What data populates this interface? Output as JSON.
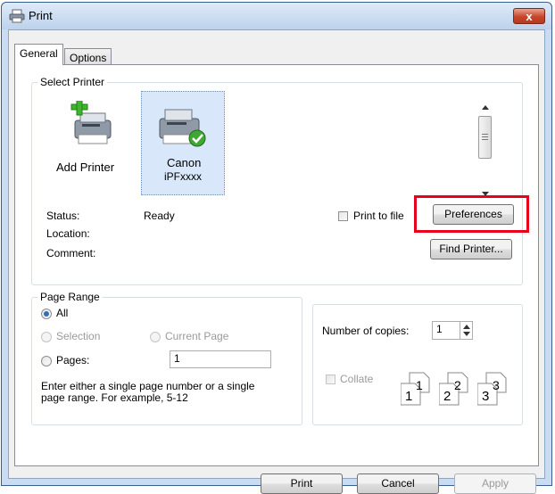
{
  "window": {
    "title": "Print",
    "close_glyph": "x",
    "close_color": "#c8462b"
  },
  "tabs": [
    {
      "label": "General"
    },
    {
      "label": "Options"
    }
  ],
  "select_printer": {
    "group_label": "Select Printer",
    "printers": [
      {
        "name": "Add Printer",
        "icon": "add-printer-icon",
        "selected": false
      },
      {
        "name_line1": "Canon",
        "name_line2": "iPFxxxx",
        "icon": "canon-printer-icon",
        "selected": true
      }
    ],
    "status_label": "Status:",
    "status_value": "Ready",
    "location_label": "Location:",
    "comment_label": "Comment:",
    "print_to_file_label": "Print to file",
    "preferences_label": "Preferences",
    "find_printer_label": "Find Printer...",
    "highlight_color": "#e8001c"
  },
  "page_range": {
    "group_label": "Page Range",
    "all_label": "All",
    "selection_label": "Selection",
    "current_page_label": "Current Page",
    "pages_label": "Pages:",
    "pages_value": "1",
    "hint_line1": "Enter either a single page number or a single",
    "hint_line2": "page range.  For example, 5-12"
  },
  "copies": {
    "number_label": "Number of copies:",
    "number_value": "1",
    "collate_label": "Collate",
    "collate_icons": [
      {
        "big": "1",
        "small": "1"
      },
      {
        "big": "2",
        "small": "2"
      },
      {
        "big": "3",
        "small": "3"
      }
    ]
  },
  "buttons": {
    "print": "Print",
    "cancel": "Cancel",
    "apply": "Apply"
  }
}
